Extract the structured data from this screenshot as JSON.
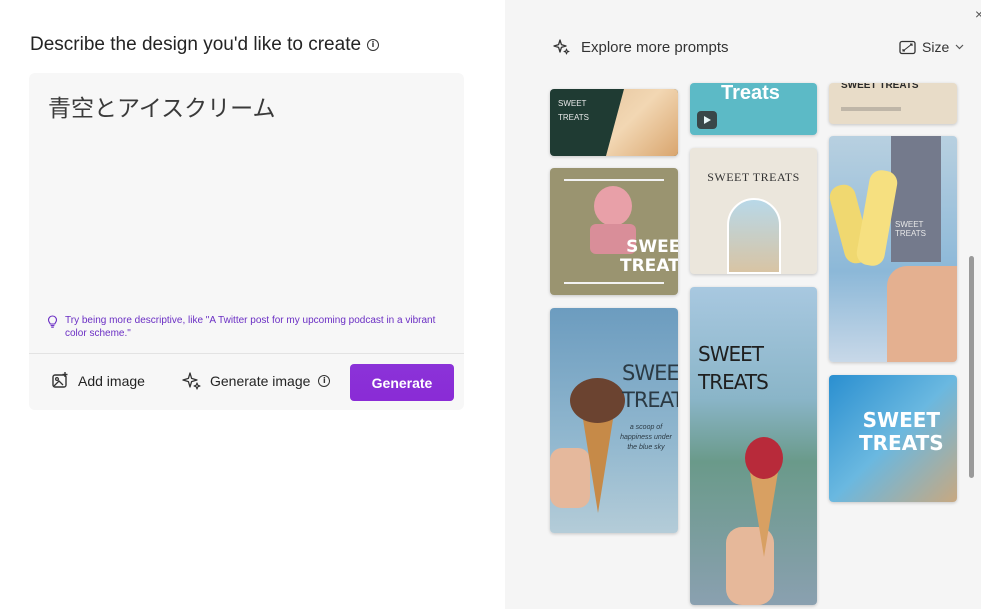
{
  "left": {
    "heading": "Describe the design you'd like to create",
    "prompt_value": "青空とアイスクリーム",
    "tip": "Try being more descriptive, like \"A Twitter post for my upcoming podcast in a vibrant color scheme.\"",
    "add_image_label": "Add image",
    "generate_image_label": "Generate image",
    "generate_button_label": "Generate",
    "info_glyph": "i"
  },
  "right": {
    "explore_label": "Explore more prompts",
    "size_label": "Size",
    "close_glyph": "×",
    "cards": [
      {
        "title_line1": "SWEET",
        "title_line2": "TREATS"
      },
      {
        "title_line1": "SWEET",
        "title_line2": "TREATS"
      },
      {
        "title_line1": "SWEET",
        "title_line2": "TREATS",
        "subtitle": "a scoop of happiness under the blue sky"
      },
      {
        "title": "Treats"
      },
      {
        "title": "SWEET TREATS"
      },
      {
        "title_line1": "SWEET",
        "title_line2": "TREATS"
      },
      {
        "title": "SWEET TREATS"
      },
      {
        "title_line1": "SWEET",
        "title_line2": "TREATS"
      },
      {
        "title_line1": "SWEET",
        "title_line2": "TREATS"
      }
    ]
  },
  "colors": {
    "accent": "#8a2be2",
    "tip": "#6b2fc4"
  },
  "icons": {
    "add_image": "image-add-icon",
    "generate_image": "sparkle-icon",
    "explore": "sparkle-icon",
    "size": "resize-icon",
    "tip": "lightbulb-icon"
  }
}
